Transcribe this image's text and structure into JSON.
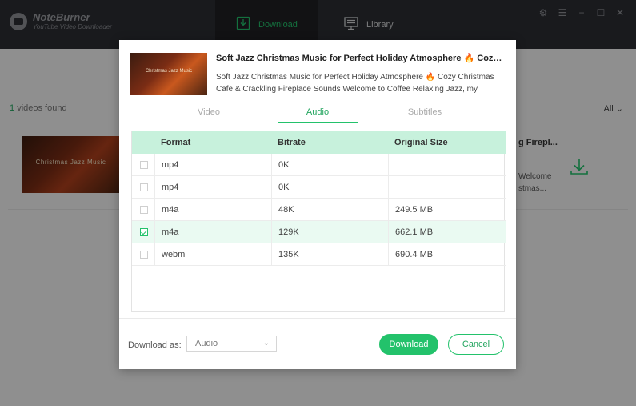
{
  "app": {
    "name": "NoteBurner",
    "subtitle": "YouTube Video Downloader"
  },
  "nav": {
    "download_label": "Download",
    "library_label": "Library"
  },
  "background": {
    "found_count": "1",
    "found_text": "videos found",
    "filter_value": "All",
    "video_title_partial": "g Firepl...",
    "video_desc_partial_1": "Welcome",
    "video_desc_partial_2": "stmas...",
    "thumb_caption": "Christmas Jazz Music"
  },
  "dialog": {
    "title": "Soft Jazz Christmas Music for Perfect Holiday Atmosphere 🔥 Cozy Christmas Cafe & Crackling Fireplace Sounds",
    "description": "Soft Jazz Christmas Music for Perfect Holiday Atmosphere 🔥 Cozy Christmas Cafe & Crackling Fireplace Sounds Welcome to Coffee Relaxing Jazz, my friend!...",
    "thumb_caption": "Christmas Jazz Music",
    "tabs": [
      {
        "label": "Video",
        "active": false
      },
      {
        "label": "Audio",
        "active": true
      },
      {
        "label": "Subtitles",
        "active": false
      }
    ],
    "table": {
      "headers": [
        "Format",
        "Bitrate",
        "Original Size"
      ],
      "rows": [
        {
          "format": "mp4",
          "bitrate": "0K",
          "size": "",
          "checked": false
        },
        {
          "format": "mp4",
          "bitrate": "0K",
          "size": "",
          "checked": false
        },
        {
          "format": "m4a",
          "bitrate": "48K",
          "size": "249.5 MB",
          "checked": false
        },
        {
          "format": "m4a",
          "bitrate": "129K",
          "size": "662.1 MB",
          "checked": true
        },
        {
          "format": "webm",
          "bitrate": "135K",
          "size": "690.4 MB",
          "checked": false
        }
      ]
    },
    "footer": {
      "download_as_label": "Download as:",
      "download_as_value": "Audio",
      "download_button": "Download",
      "cancel_button": "Cancel"
    }
  },
  "colors": {
    "accent": "#23c26b",
    "header_row": "#c7f1dc",
    "selected_row": "#eafaf2",
    "titlebar": "#2b2d33"
  }
}
